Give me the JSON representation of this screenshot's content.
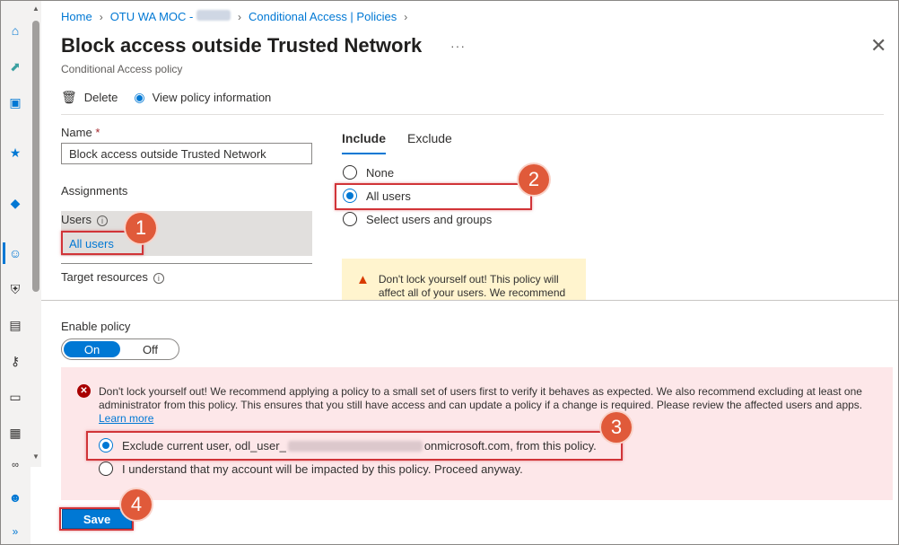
{
  "breadcrumb": {
    "home": "Home",
    "tenant": "OTU WA MOC - ",
    "policies": "Conditional Access | Policies"
  },
  "page": {
    "title": "Block access outside Trusted Network",
    "more": "···",
    "subtitle": "Conditional Access policy",
    "close": "✕"
  },
  "toolbar": {
    "delete_label": "Delete",
    "view_info_label": "View policy information"
  },
  "form": {
    "name_label": "Name",
    "required_mark": "*",
    "name_value": "Block access outside Trusted Network",
    "assignments_heading": "Assignments",
    "users_label": "Users",
    "users_value": "All users",
    "target_resources_label": "Target resources"
  },
  "include_tabs": {
    "tabs": [
      "Include",
      "Exclude"
    ],
    "options": [
      "None",
      "All users",
      "Select users and groups"
    ],
    "selected": "All users"
  },
  "warning": {
    "text": "Don't lock yourself out! This policy will affect all of your users. We recommend"
  },
  "enable_policy": {
    "label": "Enable policy",
    "on": "On",
    "off": "Off",
    "value": "On"
  },
  "lockout_error": {
    "message": "Don't lock yourself out! We recommend applying a policy to a small set of users first to verify it behaves as expected. We also recommend excluding at least one administrator from this policy. This ensures that you still have access and can update a policy if a change is required. Please review the affected users and apps.",
    "learn_more": "Learn more",
    "option1_prefix": "Exclude current user, odl_user_",
    "option1_suffix": "onmicrosoft.com, from this policy.",
    "option2": "I understand that my account will be impacted by this policy. Proceed anyway.",
    "selected_option": 1
  },
  "save_label": "Save",
  "callouts": [
    "1",
    "2",
    "3",
    "4"
  ],
  "colors": {
    "accent": "#0078d4",
    "callout": "#e05a3a",
    "highlight": "#d13438",
    "error_bg": "#fde7e9",
    "warning_bg": "#fff4ce"
  }
}
